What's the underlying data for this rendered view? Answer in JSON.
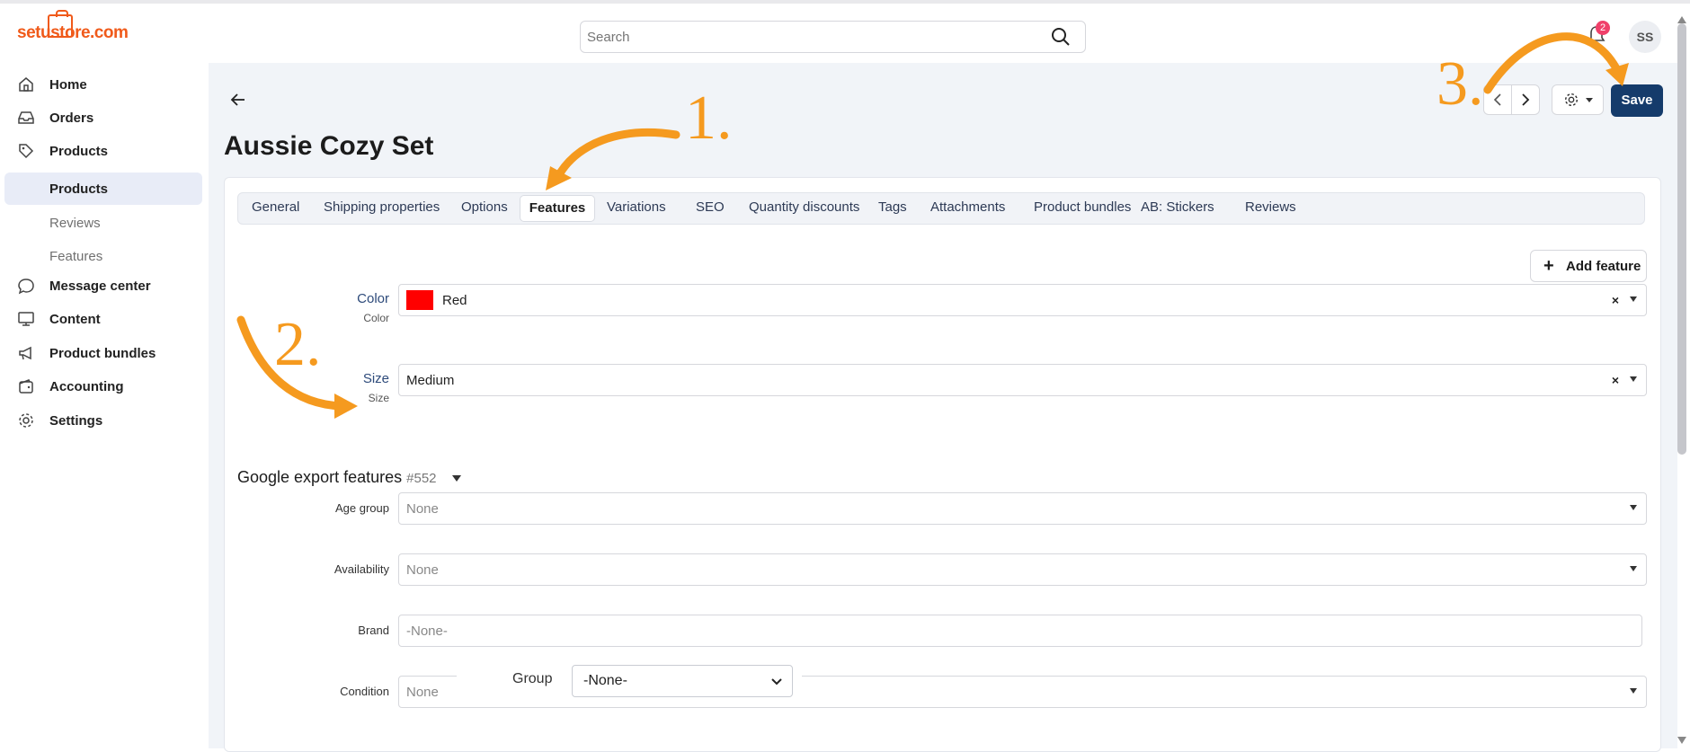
{
  "app": {
    "logo_text": "setustore.com",
    "brand_color": "#f05a1a"
  },
  "header": {
    "search_placeholder": "Search",
    "notifications_count": "2",
    "avatar_initials": "SS"
  },
  "sidebar": {
    "items": [
      {
        "label": "Home",
        "icon": "home-icon"
      },
      {
        "label": "Orders",
        "icon": "inbox-icon"
      },
      {
        "label": "Products",
        "icon": "tag-icon"
      },
      {
        "label": "Products",
        "sub": true,
        "active": true
      },
      {
        "label": "Reviews",
        "sub": true
      },
      {
        "label": "Features",
        "sub": true
      },
      {
        "label": "Message center",
        "icon": "chat-bubble-icon"
      },
      {
        "label": "Content",
        "icon": "monitor-icon"
      },
      {
        "label": "Product bundles",
        "icon": "megaphone-icon"
      },
      {
        "label": "Accounting",
        "icon": "wallet-icon"
      },
      {
        "label": "Settings",
        "icon": "gear-icon"
      }
    ]
  },
  "page": {
    "title": "Aussie Cozy Set",
    "save_label": "Save",
    "tabs": [
      "General",
      "Shipping properties",
      "Options",
      "Features",
      "Variations",
      "SEO",
      "Quantity discounts",
      "Tags",
      "Attachments",
      "Product bundles",
      "AB: Stickers",
      "Reviews"
    ],
    "active_tab": "Features",
    "add_feature_label": "Add feature"
  },
  "features": {
    "color": {
      "label": "Color",
      "sublabel": "Color",
      "value": "Red",
      "swatch": "#ff0000"
    },
    "size": {
      "label": "Size",
      "sublabel": "Size",
      "value": "Medium"
    }
  },
  "google": {
    "title": "Google export features",
    "id": "#552",
    "fields": [
      {
        "label": "Age group",
        "value": "None"
      },
      {
        "label": "Availability",
        "value": "None"
      },
      {
        "label": "Brand",
        "value": "-None-"
      },
      {
        "label": "Condition",
        "value": "None"
      }
    ]
  },
  "group_popup": {
    "label": "Group",
    "value": "-None-"
  },
  "annotations": {
    "step1": "1.",
    "step2": "2.",
    "step3": "3.",
    "color": "#f59a1f"
  }
}
